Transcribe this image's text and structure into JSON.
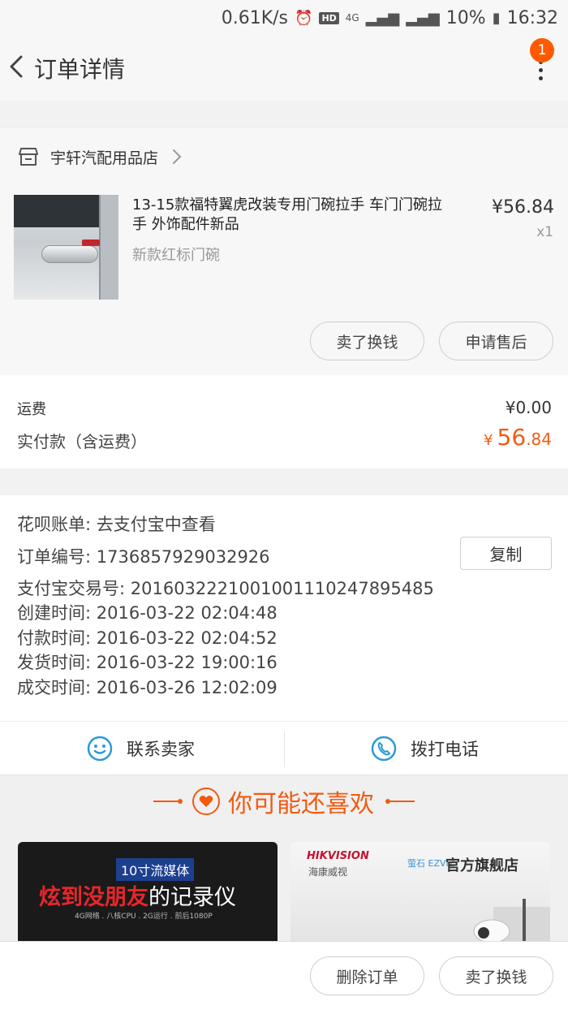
{
  "status_bar": {
    "net_speed": "0.61K/s",
    "hd": "HD",
    "network": "4G",
    "battery": "10%",
    "time": "16:32"
  },
  "nav": {
    "title": "订单详情",
    "badge_count": "1"
  },
  "store": {
    "name": "宇轩汽配用品店"
  },
  "product": {
    "title": "13-15款福特翼虎改装专用门碗拉手 车门门碗拉手 外饰配件新品",
    "sku": "新款红标门碗",
    "price": "¥56.84",
    "quantity": "x1"
  },
  "item_actions": {
    "sell_label": "卖了换钱",
    "after_sales_label": "申请售后"
  },
  "costs": {
    "shipping_label": "运费",
    "shipping_value": "¥0.00",
    "total_label": "实付款（含运费）",
    "total_symbol": "¥",
    "total_integer": "56",
    "total_decimal": ".84"
  },
  "order_info": {
    "huabei": "花呗账单:  去支付宝中查看",
    "order_no": "订单编号:  1736857929032926",
    "copy_label": "复制",
    "alipay_no": "支付宝交易号:  2016032221001001110247895485",
    "created": "创建时间:  2016-03-22 02:04:48",
    "paid": "付款时间:  2016-03-22 02:04:52",
    "shipped": "发货时间:  2016-03-22 19:00:16",
    "completed": "成交时间:  2016-03-26 12:02:09"
  },
  "contact": {
    "seller_label": "联系卖家",
    "phone_label": "拨打电话"
  },
  "recommend": {
    "title": "你可能还喜欢",
    "card1": {
      "tag": "10寸流媒体",
      "headline_red": "炫到没朋友",
      "headline_white": "的记录仪",
      "sub": "4G网络 . 八核CPU . 2G运行 . 前后1080P"
    },
    "card2": {
      "brand": "HIKVISION",
      "brand_cn": "海康威视",
      "ezviz": "萤石 EZVIZ",
      "store": "官方旗舰店"
    }
  },
  "bottom_actions": {
    "delete_label": "删除订单",
    "sell_label": "卖了换钱"
  },
  "colors": {
    "accent": "#f25a11",
    "badge": "#ff5a00",
    "icon_blue": "#2c9ad8"
  }
}
